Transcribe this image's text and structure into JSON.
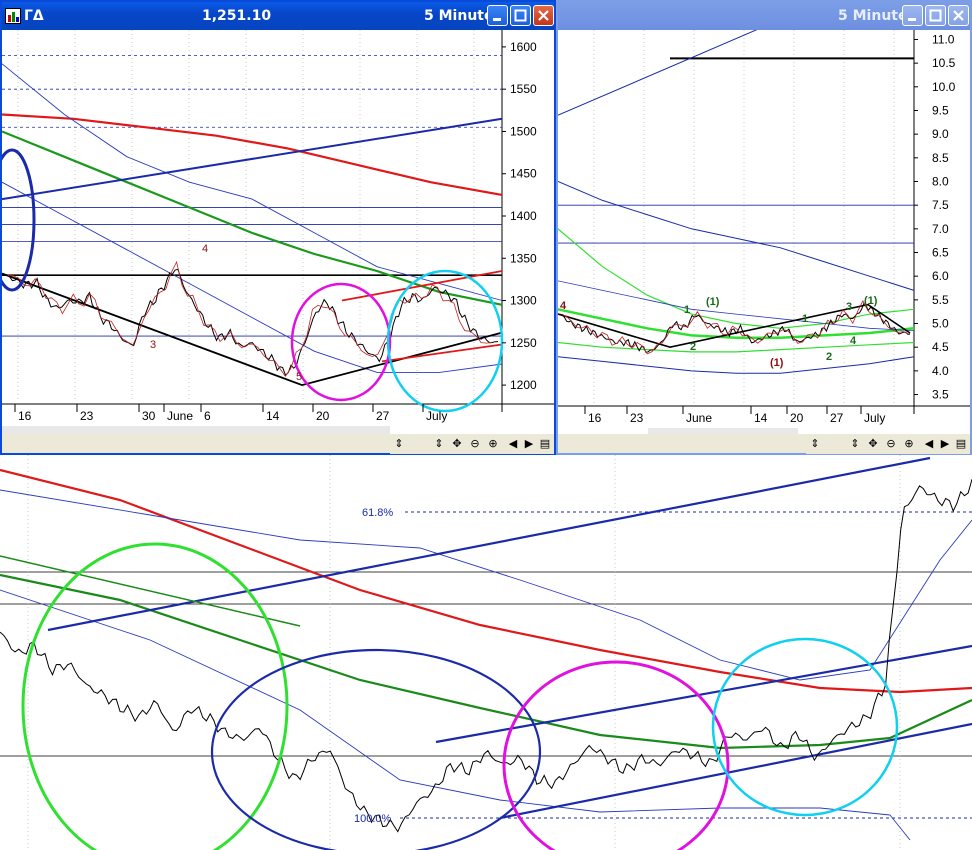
{
  "windows": {
    "left": {
      "icon": "chart-icon",
      "symbol": "ΓΔ",
      "price": "1,251.10",
      "interval": "5 Minute",
      "y_labels": [
        "1600",
        "1550",
        "1500",
        "1450",
        "1400",
        "1350",
        "1300",
        "1250",
        "1200"
      ],
      "x_labels": [
        "16",
        "23",
        "30",
        "June",
        "6",
        "14",
        "20",
        "27",
        "July"
      ],
      "wave_labels": [
        "3",
        "4",
        "5"
      ]
    },
    "right": {
      "interval": "5 Minute",
      "y_labels": [
        "11.0",
        "10.5",
        "10.0",
        "9.5",
        "9.0",
        "8.5",
        "8.0",
        "7.5",
        "7.0",
        "6.5",
        "6.0",
        "5.5",
        "5.0",
        "4.5",
        "4.0",
        "3.5"
      ],
      "x_labels": [
        "16",
        "23",
        "June",
        "14",
        "20",
        "27",
        "July"
      ],
      "wave_labels": [
        "4",
        "1",
        "(1)",
        "2",
        "1",
        "(1)",
        "2",
        "3",
        "(1)",
        "4"
      ]
    }
  },
  "toolbar_icons": [
    "scroll-icon",
    "zoom-vertical-icon",
    "pan-icon",
    "zoom-out-icon",
    "zoom-in-icon",
    "prev-icon",
    "next-icon",
    "menu-icon"
  ],
  "toolbar_glyphs": [
    "⇕",
    "⇕",
    "✥",
    "⊖",
    "⊕",
    "◀",
    "▶",
    "▤"
  ],
  "bottom_chart": {
    "fib_labels": [
      "61.8%",
      "100.0%"
    ]
  },
  "chart_data": [
    {
      "type": "line",
      "panel": "left window",
      "ylim": [
        1180,
        1620
      ],
      "y_ticks": [
        1600,
        1550,
        1500,
        1450,
        1400,
        1350,
        1300,
        1250,
        1200
      ],
      "x_ticks": [
        "16",
        "23",
        "30",
        "June",
        "6",
        "14",
        "20",
        "27",
        "July"
      ],
      "series": [
        {
          "values": [
            1330,
            1325,
            1318,
            1322,
            1300,
            1290,
            1300,
            1298,
            1305,
            1280,
            1270,
            1255,
            1245,
            1285,
            1300,
            1320,
            1340,
            1310,
            1290,
            1270,
            1255,
            1262,
            1245,
            1250,
            1240,
            1230,
            1215,
            1220,
            1250,
            1285,
            1300,
            1280,
            1262,
            1250,
            1238,
            1230,
            1260,
            1295,
            1305,
            1300,
            1315,
            1310,
            1300,
            1275,
            1260,
            1252,
            1250
          ]
        }
      ],
      "reference_lines": [
        1590,
        1550,
        1505,
        1410,
        1390,
        1370,
        1330,
        1258
      ],
      "annotations": [
        "3",
        "4",
        "5"
      ]
    },
    {
      "type": "line",
      "panel": "right window",
      "ylim": [
        3.3,
        11.2
      ],
      "y_ticks": [
        11.0,
        10.5,
        10.0,
        9.5,
        9.0,
        8.5,
        8.0,
        7.5,
        7.0,
        6.5,
        6.0,
        5.5,
        5.0,
        4.5,
        4.0,
        3.5
      ],
      "x_ticks": [
        "16",
        "23",
        "June",
        "14",
        "20",
        "27",
        "July"
      ],
      "series": [
        {
          "values": [
            5.2,
            5.0,
            4.9,
            4.8,
            4.7,
            4.6,
            4.6,
            4.5,
            4.4,
            4.6,
            5.0,
            4.9,
            5.2,
            5.0,
            4.9,
            4.8,
            4.9,
            4.6,
            4.7,
            4.8,
            4.9,
            4.6,
            4.7,
            4.8,
            5.0,
            5.2,
            5.1,
            5.4,
            5.2,
            5.0,
            4.8,
            4.8
          ]
        }
      ],
      "reference_lines": [
        10.6,
        7.5,
        6.7
      ],
      "annotations": [
        "4",
        "1",
        "(1)",
        "2",
        "1",
        "(1)",
        "2",
        "3",
        "(1)",
        "4"
      ]
    },
    {
      "type": "line",
      "panel": "bottom chart",
      "series": [
        {
          "values": [
            0.62,
            0.55,
            0.58,
            0.5,
            0.52,
            0.45,
            0.42,
            0.38,
            0.35,
            0.4,
            0.3,
            0.38,
            0.35,
            0.3,
            0.28,
            0.32,
            0.22,
            0.15,
            0.22,
            0.25,
            0.12,
            0.05,
            0.02,
            0.0,
            0.08,
            0.12,
            0.2,
            0.18,
            0.24,
            0.2,
            0.22,
            0.15,
            0.14,
            0.2,
            0.26,
            0.22,
            0.18,
            0.22,
            0.2,
            0.25,
            0.23,
            0.2,
            0.3,
            0.28,
            0.32,
            0.25,
            0.3,
            0.22,
            0.28,
            0.32,
            0.35,
            0.45,
            1.0,
            1.08,
            1.04,
            1.02,
            1.09
          ]
        }
      ],
      "annotations": [
        "61.8%",
        "100.0%"
      ]
    }
  ]
}
